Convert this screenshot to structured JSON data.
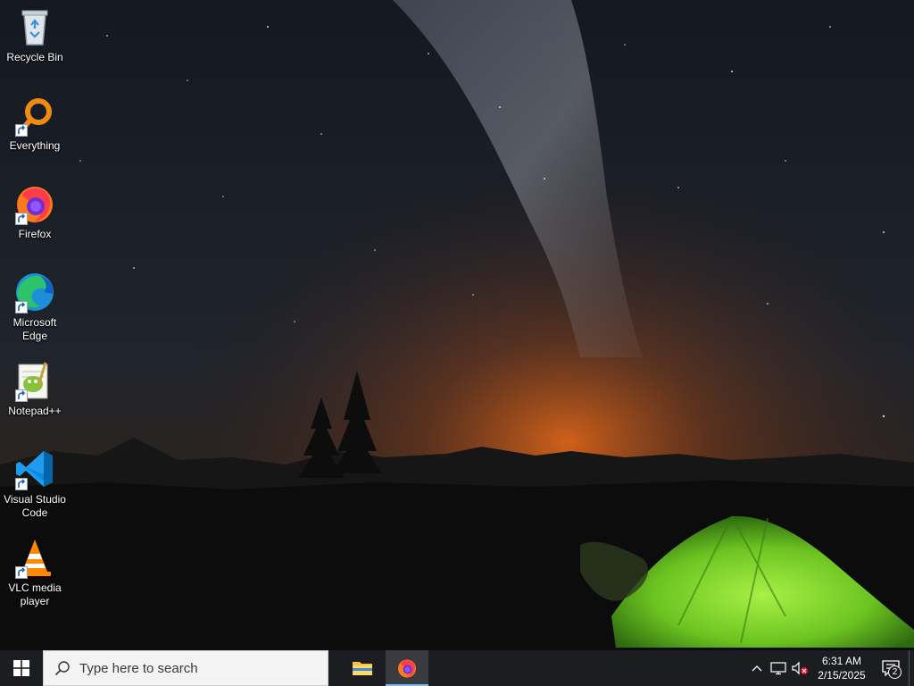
{
  "desktop": {
    "icons": [
      {
        "label": "Recycle Bin",
        "icon": "recycle-bin-icon"
      },
      {
        "label": "Everything",
        "icon": "everything-search-icon"
      },
      {
        "label": "Firefox",
        "icon": "firefox-icon"
      },
      {
        "label": "Microsoft Edge",
        "icon": "edge-icon"
      },
      {
        "label": "Notepad++",
        "icon": "notepadpp-icon"
      },
      {
        "label": "Visual Studio Code",
        "icon": "vscode-icon"
      },
      {
        "label": "VLC media player",
        "icon": "vlc-icon"
      }
    ]
  },
  "taskbar": {
    "search_placeholder": "Type here to search",
    "pinned": [
      "file-explorer-icon",
      "firefox-icon"
    ],
    "tray_icons": [
      "chevron-up-icon",
      "network-icon",
      "volume-muted-icon"
    ],
    "time": "6:31 AM",
    "date": "2/15/2025",
    "notification_count": "2"
  },
  "colors": {
    "taskbar_bg": "#1c1d21",
    "accent": "#76b9ed",
    "tent_green": "#7fd62b",
    "horizon_orange": "#d9641a"
  }
}
